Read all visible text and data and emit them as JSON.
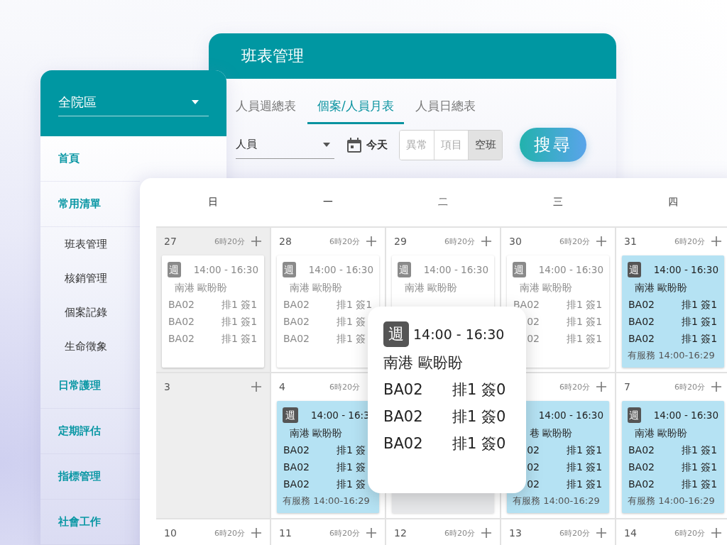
{
  "sidebar": {
    "region_select": {
      "value": "全院區"
    },
    "items": [
      {
        "label": "首頁"
      },
      {
        "label": "常用清單",
        "children": [
          {
            "label": "班表管理"
          },
          {
            "label": "核銷管理"
          },
          {
            "label": "個案記錄"
          },
          {
            "label": "生命徵象"
          }
        ]
      },
      {
        "label": "日常護理"
      },
      {
        "label": "定期評估"
      },
      {
        "label": "指標管理"
      },
      {
        "label": "社會工作"
      }
    ]
  },
  "schedule_panel": {
    "title": "班表管理",
    "tabs": [
      {
        "label": "人員週總表",
        "selected": false
      },
      {
        "label": "個案/人員月表",
        "selected": true
      },
      {
        "label": "人員日總表",
        "selected": false
      }
    ],
    "filters": {
      "person_select": {
        "value": "人員"
      },
      "today_button": "今天",
      "toggles": [
        {
          "label": "異常",
          "selected": false
        },
        {
          "label": "項目",
          "selected": false
        },
        {
          "label": "空班",
          "selected": true
        }
      ],
      "search_button": "搜尋"
    }
  },
  "calendar": {
    "weekdays": [
      "日",
      "一",
      "二",
      "三",
      "四"
    ],
    "weeks": [
      {
        "days": [
          {
            "date": "27",
            "hours": "6時20分",
            "add": true,
            "shaded": true,
            "card": {
              "kind": "past",
              "badge": "週",
              "time": "14:00 - 16:30",
              "name": "南港 歐盼盼",
              "rows": [
                {
                  "code": "BA02",
                  "status": "排1 簽1"
                },
                {
                  "code": "BA02",
                  "status": "排1 簽1"
                },
                {
                  "code": "BA02",
                  "status": "排1 簽1"
                }
              ]
            }
          },
          {
            "date": "28",
            "hours": "6時20分",
            "add": true,
            "shaded": false,
            "card": {
              "kind": "past",
              "badge": "週",
              "time": "14:00 - 16:30",
              "name": "南港 歐盼盼",
              "rows": [
                {
                  "code": "BA02",
                  "status": "排1 簽1"
                },
                {
                  "code": "BA02",
                  "status": "排1 簽"
                },
                {
                  "code": "BA02",
                  "status": "排1 簽"
                }
              ]
            }
          },
          {
            "date": "29",
            "hours": "6時20分",
            "add": true,
            "shaded": false,
            "card": {
              "kind": "past",
              "badge": "週",
              "time": "14:00 - 16:30",
              "name": "南港 歐盼盼"
            }
          },
          {
            "date": "30",
            "hours": "6時20分",
            "add": true,
            "shaded": false,
            "card": {
              "kind": "past",
              "badge": "週",
              "time": "14:00 - 16:30",
              "name": "南港 歐盼盼",
              "rows": [
                {
                  "code": "BA02",
                  "status": "排1 簽1"
                },
                {
                  "code": "02",
                  "status": "排1 簽1"
                },
                {
                  "code": "02",
                  "status": "排1 簽1"
                }
              ]
            }
          },
          {
            "date": "31",
            "hours": "6時20分",
            "add": true,
            "shaded": false,
            "card": {
              "kind": "upcoming",
              "badge": "週",
              "time": "14:00 - 16:30",
              "name": "南港 歐盼盼",
              "rows": [
                {
                  "code": "BA02",
                  "status": "排1 簽1"
                },
                {
                  "code": "BA02",
                  "status": "排1 簽1"
                },
                {
                  "code": "BA02",
                  "status": "排1 簽1"
                }
              ],
              "footer": "有服務 14:00-16:29"
            }
          }
        ]
      },
      {
        "days": [
          {
            "date": "3",
            "add": true,
            "shaded": true
          },
          {
            "date": "4",
            "hours": "6時20分",
            "add": false,
            "shaded": false,
            "card": {
              "kind": "upcoming",
              "badge": "週",
              "time": "14:00 - 16:3",
              "name": "南港 歐盼盼",
              "rows": [
                {
                  "code": "BA02",
                  "status": "排1 簽"
                },
                {
                  "code": "BA02",
                  "status": "排1 簽"
                },
                {
                  "code": "BA02",
                  "status": "排1 簽"
                }
              ],
              "footer": "有服務 14:00-16:29"
            }
          },
          {
            "add": false,
            "shaded": false,
            "card": {
              "kind": "blank"
            }
          },
          {
            "hours": "6時20分",
            "add": true,
            "shaded": false,
            "card": {
              "kind": "upcoming",
              "time": "14:00 - 16:30",
              "name": "巷 歐盼盼",
              "rows": [
                {
                  "code": "02",
                  "status": "排1 簽1"
                },
                {
                  "code": "02",
                  "status": "排1 簽1"
                },
                {
                  "code": "02",
                  "status": "排1 簽1"
                }
              ],
              "footer": "有服務 14:00-16:29"
            }
          },
          {
            "date": "7",
            "hours": "6時20分",
            "add": true,
            "shaded": false,
            "card": {
              "kind": "upcoming",
              "badge": "週",
              "time": "14:00 - 16:30",
              "name": "南港 歐盼盼",
              "rows": [
                {
                  "code": "BA02",
                  "status": "排1 簽1"
                },
                {
                  "code": "BA02",
                  "status": "排1 簽1"
                },
                {
                  "code": "BA02",
                  "status": "排1 簽1"
                }
              ],
              "footer": "有服務 14:00-16:29"
            }
          }
        ]
      },
      {
        "days": [
          {
            "date": "10",
            "hours": "6時20分",
            "add": true,
            "shaded": false
          },
          {
            "date": "11",
            "hours": "6時20分",
            "add": true,
            "shaded": false
          },
          {
            "date": "12",
            "hours": "6時20分",
            "add": true,
            "shaded": false
          },
          {
            "date": "13",
            "hours": "6時20分",
            "add": true,
            "shaded": false
          },
          {
            "date": "14",
            "hours": "6時20分",
            "add": true,
            "shaded": false
          }
        ]
      }
    ]
  },
  "popup": {
    "badge": "週",
    "time": "14:00 - 16:30",
    "name": "南港 歐盼盼",
    "rows": [
      {
        "code": "BA02",
        "status": "排1 簽0"
      },
      {
        "code": "BA02",
        "status": "排1 簽0"
      },
      {
        "code": "BA02",
        "status": "排1 簽0"
      }
    ]
  }
}
